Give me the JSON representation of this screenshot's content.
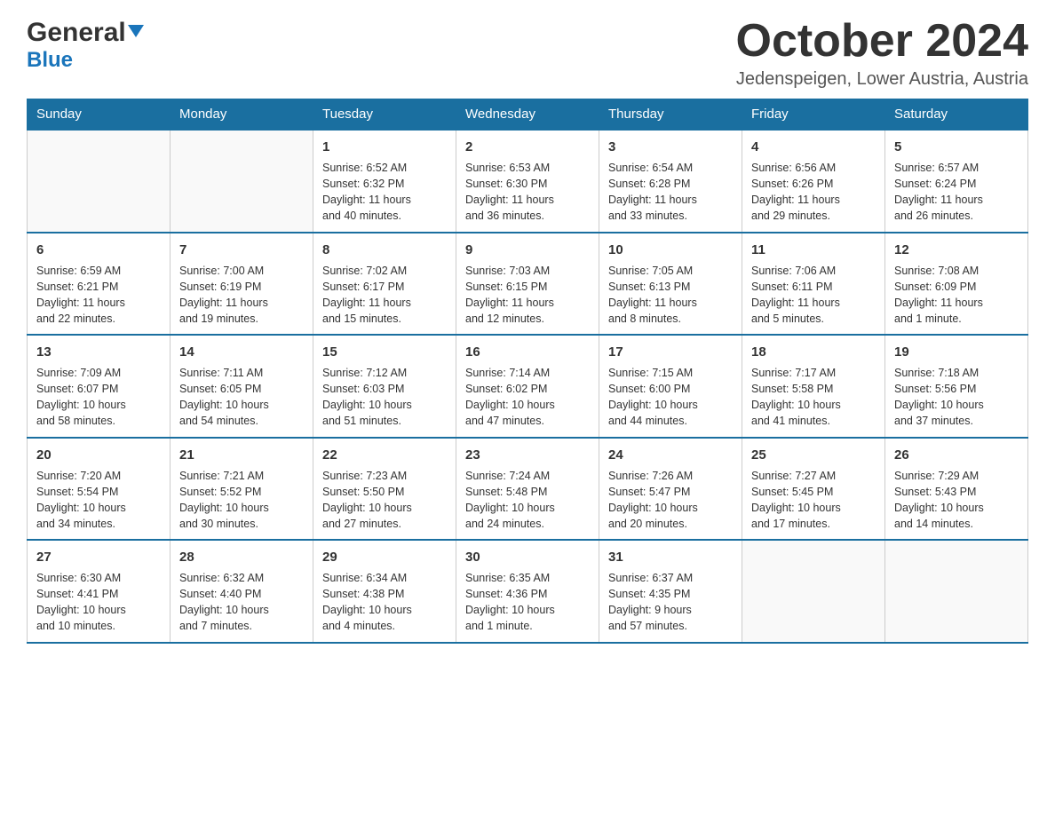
{
  "header": {
    "logo_general": "General",
    "logo_blue": "Blue",
    "month_title": "October 2024",
    "location": "Jedenspeigen, Lower Austria, Austria"
  },
  "weekdays": [
    "Sunday",
    "Monday",
    "Tuesday",
    "Wednesday",
    "Thursday",
    "Friday",
    "Saturday"
  ],
  "weeks": [
    [
      {
        "day": "",
        "info": ""
      },
      {
        "day": "",
        "info": ""
      },
      {
        "day": "1",
        "info": "Sunrise: 6:52 AM\nSunset: 6:32 PM\nDaylight: 11 hours\nand 40 minutes."
      },
      {
        "day": "2",
        "info": "Sunrise: 6:53 AM\nSunset: 6:30 PM\nDaylight: 11 hours\nand 36 minutes."
      },
      {
        "day": "3",
        "info": "Sunrise: 6:54 AM\nSunset: 6:28 PM\nDaylight: 11 hours\nand 33 minutes."
      },
      {
        "day": "4",
        "info": "Sunrise: 6:56 AM\nSunset: 6:26 PM\nDaylight: 11 hours\nand 29 minutes."
      },
      {
        "day": "5",
        "info": "Sunrise: 6:57 AM\nSunset: 6:24 PM\nDaylight: 11 hours\nand 26 minutes."
      }
    ],
    [
      {
        "day": "6",
        "info": "Sunrise: 6:59 AM\nSunset: 6:21 PM\nDaylight: 11 hours\nand 22 minutes."
      },
      {
        "day": "7",
        "info": "Sunrise: 7:00 AM\nSunset: 6:19 PM\nDaylight: 11 hours\nand 19 minutes."
      },
      {
        "day": "8",
        "info": "Sunrise: 7:02 AM\nSunset: 6:17 PM\nDaylight: 11 hours\nand 15 minutes."
      },
      {
        "day": "9",
        "info": "Sunrise: 7:03 AM\nSunset: 6:15 PM\nDaylight: 11 hours\nand 12 minutes."
      },
      {
        "day": "10",
        "info": "Sunrise: 7:05 AM\nSunset: 6:13 PM\nDaylight: 11 hours\nand 8 minutes."
      },
      {
        "day": "11",
        "info": "Sunrise: 7:06 AM\nSunset: 6:11 PM\nDaylight: 11 hours\nand 5 minutes."
      },
      {
        "day": "12",
        "info": "Sunrise: 7:08 AM\nSunset: 6:09 PM\nDaylight: 11 hours\nand 1 minute."
      }
    ],
    [
      {
        "day": "13",
        "info": "Sunrise: 7:09 AM\nSunset: 6:07 PM\nDaylight: 10 hours\nand 58 minutes."
      },
      {
        "day": "14",
        "info": "Sunrise: 7:11 AM\nSunset: 6:05 PM\nDaylight: 10 hours\nand 54 minutes."
      },
      {
        "day": "15",
        "info": "Sunrise: 7:12 AM\nSunset: 6:03 PM\nDaylight: 10 hours\nand 51 minutes."
      },
      {
        "day": "16",
        "info": "Sunrise: 7:14 AM\nSunset: 6:02 PM\nDaylight: 10 hours\nand 47 minutes."
      },
      {
        "day": "17",
        "info": "Sunrise: 7:15 AM\nSunset: 6:00 PM\nDaylight: 10 hours\nand 44 minutes."
      },
      {
        "day": "18",
        "info": "Sunrise: 7:17 AM\nSunset: 5:58 PM\nDaylight: 10 hours\nand 41 minutes."
      },
      {
        "day": "19",
        "info": "Sunrise: 7:18 AM\nSunset: 5:56 PM\nDaylight: 10 hours\nand 37 minutes."
      }
    ],
    [
      {
        "day": "20",
        "info": "Sunrise: 7:20 AM\nSunset: 5:54 PM\nDaylight: 10 hours\nand 34 minutes."
      },
      {
        "day": "21",
        "info": "Sunrise: 7:21 AM\nSunset: 5:52 PM\nDaylight: 10 hours\nand 30 minutes."
      },
      {
        "day": "22",
        "info": "Sunrise: 7:23 AM\nSunset: 5:50 PM\nDaylight: 10 hours\nand 27 minutes."
      },
      {
        "day": "23",
        "info": "Sunrise: 7:24 AM\nSunset: 5:48 PM\nDaylight: 10 hours\nand 24 minutes."
      },
      {
        "day": "24",
        "info": "Sunrise: 7:26 AM\nSunset: 5:47 PM\nDaylight: 10 hours\nand 20 minutes."
      },
      {
        "day": "25",
        "info": "Sunrise: 7:27 AM\nSunset: 5:45 PM\nDaylight: 10 hours\nand 17 minutes."
      },
      {
        "day": "26",
        "info": "Sunrise: 7:29 AM\nSunset: 5:43 PM\nDaylight: 10 hours\nand 14 minutes."
      }
    ],
    [
      {
        "day": "27",
        "info": "Sunrise: 6:30 AM\nSunset: 4:41 PM\nDaylight: 10 hours\nand 10 minutes."
      },
      {
        "day": "28",
        "info": "Sunrise: 6:32 AM\nSunset: 4:40 PM\nDaylight: 10 hours\nand 7 minutes."
      },
      {
        "day": "29",
        "info": "Sunrise: 6:34 AM\nSunset: 4:38 PM\nDaylight: 10 hours\nand 4 minutes."
      },
      {
        "day": "30",
        "info": "Sunrise: 6:35 AM\nSunset: 4:36 PM\nDaylight: 10 hours\nand 1 minute."
      },
      {
        "day": "31",
        "info": "Sunrise: 6:37 AM\nSunset: 4:35 PM\nDaylight: 9 hours\nand 57 minutes."
      },
      {
        "day": "",
        "info": ""
      },
      {
        "day": "",
        "info": ""
      }
    ]
  ]
}
